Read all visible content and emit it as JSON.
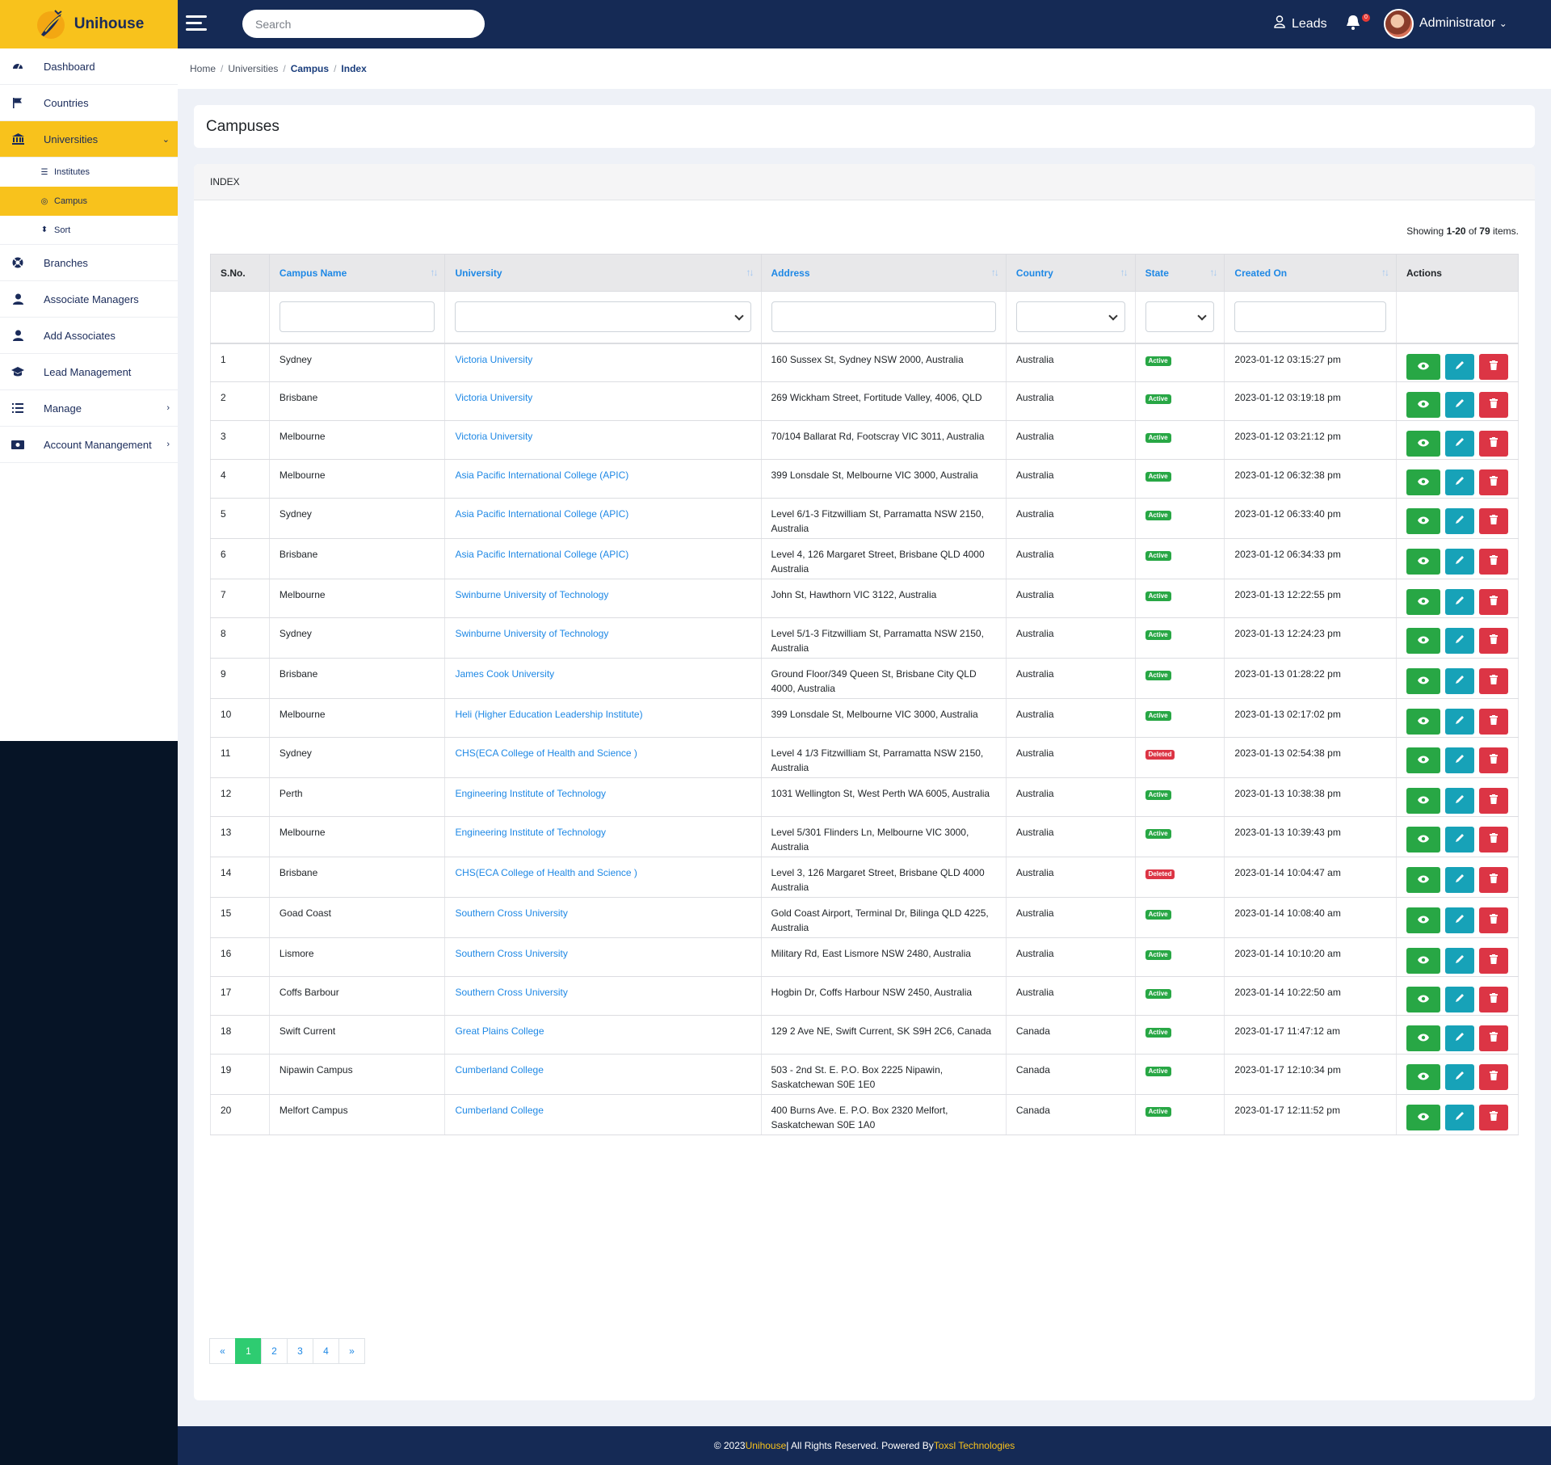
{
  "brand": {
    "name": "Unihouse"
  },
  "topbar": {
    "search_placeholder": "Search",
    "leads_label": "Leads",
    "notifications_count": "0",
    "user_label": "Administrator"
  },
  "sidebar": {
    "items": [
      {
        "label": "Dashboard",
        "icon": "speedometer-icon"
      },
      {
        "label": "Countries",
        "icon": "flag-icon"
      },
      {
        "label": "Universities",
        "icon": "university-icon"
      },
      {
        "label": "Institutes",
        "icon": "list-icon"
      },
      {
        "label": "Campus",
        "icon": "target-icon"
      },
      {
        "label": "Sort",
        "icon": "sort-icon"
      },
      {
        "label": "Branches",
        "icon": "support-icon"
      },
      {
        "label": "Associate Managers",
        "icon": "user-icon"
      },
      {
        "label": "Add Associates",
        "icon": "user-icon"
      },
      {
        "label": "Lead Management",
        "icon": "graduation-cap-icon"
      },
      {
        "label": "Manage",
        "icon": "tasks-icon"
      },
      {
        "label": "Account Manangement",
        "icon": "money-icon"
      }
    ]
  },
  "breadcrumb": {
    "items": [
      "Home",
      "Universities",
      "Campus",
      "Index"
    ]
  },
  "page": {
    "title": "Campuses",
    "section": "INDEX"
  },
  "summary": {
    "prefix": "Showing ",
    "range": "1-20",
    "of": " of ",
    "total": "79",
    "suffix": " items."
  },
  "table": {
    "headers": [
      "S.No.",
      "Campus Name",
      "University",
      "Address",
      "Country",
      "State",
      "Created On",
      "Actions"
    ],
    "rows": [
      {
        "sno": "1",
        "campus": "Sydney",
        "university": "Victoria University",
        "address": "160 Sussex St, Sydney NSW 2000, Australia",
        "country": "Australia",
        "state": "Active",
        "created": "2023-01-12 03:15:27 pm"
      },
      {
        "sno": "2",
        "campus": "Brisbane",
        "university": "Victoria University",
        "address": "269 Wickham Street, Fortitude Valley, 4006, QLD",
        "country": "Australia",
        "state": "Active",
        "created": "2023-01-12 03:19:18 pm"
      },
      {
        "sno": "3",
        "campus": "Melbourne",
        "university": "Victoria University",
        "address": "70/104 Ballarat Rd, Footscray VIC 3011, Australia",
        "country": "Australia",
        "state": "Active",
        "created": "2023-01-12 03:21:12 pm"
      },
      {
        "sno": "4",
        "campus": "Melbourne",
        "university": "Asia Pacific International College (APIC)",
        "address": "399 Lonsdale St, Melbourne VIC 3000, Australia",
        "country": "Australia",
        "state": "Active",
        "created": "2023-01-12 06:32:38 pm"
      },
      {
        "sno": "5",
        "campus": "Sydney",
        "university": "Asia Pacific International College (APIC)",
        "address": "Level 6/1-3 Fitzwilliam St, Parramatta NSW 2150, Australia",
        "country": "Australia",
        "state": "Active",
        "created": "2023-01-12 06:33:40 pm"
      },
      {
        "sno": "6",
        "campus": "Brisbane",
        "university": "Asia Pacific International College (APIC)",
        "address": "Level 4, 126 Margaret Street, Brisbane QLD 4000 Australia",
        "country": "Australia",
        "state": "Active",
        "created": "2023-01-12 06:34:33 pm"
      },
      {
        "sno": "7",
        "campus": "Melbourne",
        "university": "Swinburne University of Technology",
        "address": "John St, Hawthorn VIC 3122, Australia",
        "country": "Australia",
        "state": "Active",
        "created": "2023-01-13 12:22:55 pm"
      },
      {
        "sno": "8",
        "campus": "Sydney",
        "university": "Swinburne University of Technology",
        "address": "Level 5/1-3 Fitzwilliam St, Parramatta NSW 2150, Australia",
        "country": "Australia",
        "state": "Active",
        "created": "2023-01-13 12:24:23 pm"
      },
      {
        "sno": "9",
        "campus": "Brisbane",
        "university": "James Cook University",
        "address": "Ground Floor/349 Queen St, Brisbane City QLD 4000, Australia",
        "country": "Australia",
        "state": "Active",
        "created": "2023-01-13 01:28:22 pm"
      },
      {
        "sno": "10",
        "campus": "Melbourne",
        "university": "Heli (Higher Education Leadership Institute)",
        "address": "399 Lonsdale St, Melbourne VIC 3000, Australia",
        "country": "Australia",
        "state": "Active",
        "created": "2023-01-13 02:17:02 pm"
      },
      {
        "sno": "11",
        "campus": "Sydney",
        "university": "CHS(ECA College of Health and Science )",
        "address": "Level 4 1/3 Fitzwilliam St, Parramatta NSW 2150, Australia",
        "country": "Australia",
        "state": "Deleted",
        "created": "2023-01-13 02:54:38 pm"
      },
      {
        "sno": "12",
        "campus": "Perth",
        "university": "Engineering Institute of Technology",
        "address": "1031 Wellington St, West Perth WA 6005, Australia",
        "country": "Australia",
        "state": "Active",
        "created": "2023-01-13 10:38:38 pm"
      },
      {
        "sno": "13",
        "campus": "Melbourne",
        "university": "Engineering Institute of Technology",
        "address": "Level 5/301 Flinders Ln, Melbourne VIC 3000, Australia",
        "country": "Australia",
        "state": "Active",
        "created": "2023-01-13 10:39:43 pm"
      },
      {
        "sno": "14",
        "campus": "Brisbane",
        "university": "CHS(ECA College of Health and Science )",
        "address": "Level 3, 126 Margaret Street, Brisbane QLD 4000 Australia",
        "country": "Australia",
        "state": "Deleted",
        "created": "2023-01-14 10:04:47 am"
      },
      {
        "sno": "15",
        "campus": "Goad Coast",
        "university": "Southern Cross University",
        "address": "Gold Coast Airport, Terminal Dr, Bilinga QLD 4225, Australia",
        "country": "Australia",
        "state": "Active",
        "created": "2023-01-14 10:08:40 am"
      },
      {
        "sno": "16",
        "campus": "Lismore",
        "university": "Southern Cross University",
        "address": "Military Rd, East Lismore NSW 2480, Australia",
        "country": "Australia",
        "state": "Active",
        "created": "2023-01-14 10:10:20 am"
      },
      {
        "sno": "17",
        "campus": "Coffs Barbour",
        "university": "Southern Cross University",
        "address": "Hogbin Dr, Coffs Harbour NSW 2450, Australia",
        "country": "Australia",
        "state": "Active",
        "created": "2023-01-14 10:22:50 am"
      },
      {
        "sno": "18",
        "campus": "Swift Current",
        "university": "Great Plains College",
        "address": "129 2 Ave NE, Swift Current, SK S9H 2C6, Canada",
        "country": "Canada",
        "state": "Active",
        "created": "2023-01-17 11:47:12 am"
      },
      {
        "sno": "19",
        "campus": "Nipawin Campus",
        "university": "Cumberland College",
        "address": "503 - 2nd St. E. P.O. Box 2225 Nipawin, Saskatchewan S0E 1E0",
        "country": "Canada",
        "state": "Active",
        "created": "2023-01-17 12:10:34 pm"
      },
      {
        "sno": "20",
        "campus": "Melfort Campus",
        "university": "Cumberland College",
        "address": "400 Burns Ave. E. P.O. Box 2320 Melfort, Saskatchewan S0E 1A0",
        "country": "Canada",
        "state": "Active",
        "created": "2023-01-17 12:11:52 pm"
      }
    ]
  },
  "pagination": {
    "items": [
      "«",
      "1",
      "2",
      "3",
      "4",
      "»"
    ],
    "current": "1"
  },
  "footer": {
    "prefix": "© 2023 ",
    "brand": "Unihouse",
    "middle": " | All Rights Reserved. Powered By ",
    "company": "Toxsl Technologies"
  },
  "colors": {
    "brand_yellow": "#f8c21c",
    "navy": "#152a55",
    "link_blue": "#1e88e5",
    "active_green": "#28a745",
    "deleted_red": "#dc3545",
    "edit_teal": "#17a2b8"
  }
}
